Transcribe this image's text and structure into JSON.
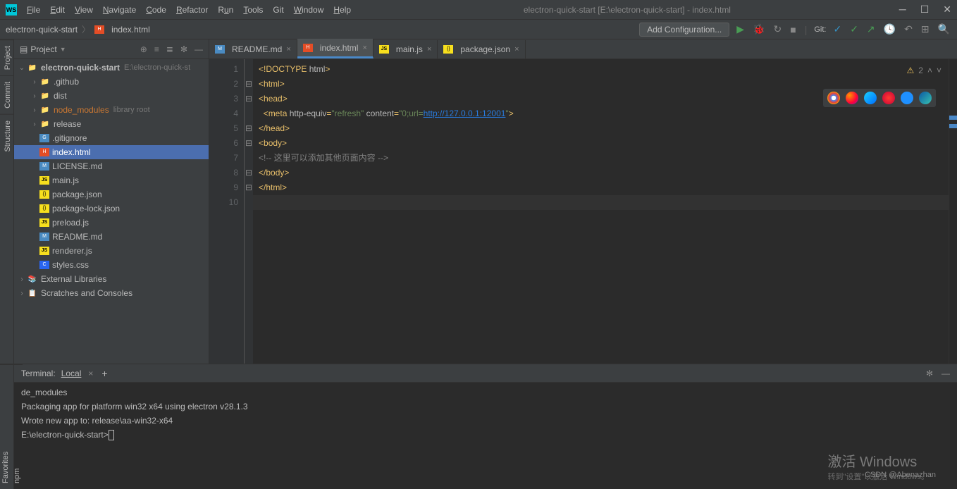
{
  "title": "electron-quick-start [E:\\electron-quick-start] - index.html",
  "menu": [
    "File",
    "Edit",
    "View",
    "Navigate",
    "Code",
    "Refactor",
    "Run",
    "Tools",
    "Git",
    "Window",
    "Help"
  ],
  "menu_underline": [
    "F",
    "E",
    "V",
    "N",
    "C",
    "R",
    "u",
    "T",
    "",
    "W",
    "H"
  ],
  "breadcrumb": {
    "root": "electron-quick-start",
    "file": "index.html"
  },
  "nav": {
    "add_config": "Add Configuration...",
    "git": "Git:"
  },
  "sidebar": {
    "title": "Project",
    "root": {
      "name": "electron-quick-start",
      "hint": "E:\\electron-quick-st"
    },
    "items": [
      {
        "name": ".github",
        "type": "folder",
        "indent": 1,
        "chevron": "›"
      },
      {
        "name": "dist",
        "type": "folder",
        "indent": 1,
        "chevron": "›"
      },
      {
        "name": "node_modules",
        "type": "folder",
        "indent": 1,
        "chevron": "›",
        "lib": true,
        "hint": "library root"
      },
      {
        "name": "release",
        "type": "folder",
        "indent": 1,
        "chevron": "›"
      },
      {
        "name": ".gitignore",
        "type": "file",
        "icon": "git",
        "indent": 1
      },
      {
        "name": "index.html",
        "type": "file",
        "icon": "html",
        "indent": 1,
        "selected": true
      },
      {
        "name": "LICENSE.md",
        "type": "file",
        "icon": "md",
        "indent": 1
      },
      {
        "name": "main.js",
        "type": "file",
        "icon": "js",
        "indent": 1
      },
      {
        "name": "package.json",
        "type": "file",
        "icon": "json",
        "indent": 1
      },
      {
        "name": "package-lock.json",
        "type": "file",
        "icon": "json",
        "indent": 1
      },
      {
        "name": "preload.js",
        "type": "file",
        "icon": "js",
        "indent": 1
      },
      {
        "name": "README.md",
        "type": "file",
        "icon": "md",
        "indent": 1
      },
      {
        "name": "renderer.js",
        "type": "file",
        "icon": "js",
        "indent": 1
      },
      {
        "name": "styles.css",
        "type": "file",
        "icon": "css",
        "indent": 1
      }
    ],
    "ext_libs": "External Libraries",
    "scratches": "Scratches and Consoles"
  },
  "tabs": [
    {
      "label": "README.md",
      "icon": "md",
      "active": false
    },
    {
      "label": "index.html",
      "icon": "html",
      "active": true
    },
    {
      "label": "main.js",
      "icon": "js",
      "active": false
    },
    {
      "label": "package.json",
      "icon": "json",
      "active": false
    }
  ],
  "editor": {
    "warnings": "2",
    "lines": [
      {
        "n": 1,
        "html": "<span class='punct'>&lt;!</span><span class='tag'>DOCTYPE </span><span class='attr'>html</span><span class='punct'>&gt;</span>"
      },
      {
        "n": 2,
        "html": "<span class='punct'>&lt;</span><span class='tag'>html</span><span class='punct'>&gt;</span>",
        "fold": "⊟"
      },
      {
        "n": 3,
        "html": "<span class='punct'>&lt;</span><span class='tag'>head</span><span class='punct'>&gt;</span>",
        "fold": "⊟"
      },
      {
        "n": 4,
        "html": "  <span class='punct'>&lt;</span><span class='tag'>meta </span><span class='attr'>http-equiv</span><span class='punct'>=</span><span class='str'>\"refresh\"</span> <span class='attr'>content</span><span class='punct'>=</span><span class='str'>\"0;url=</span><span class='link'>http://127.0.0.1:12001</span><span class='str'>\"</span><span class='punct'>&gt;</span>"
      },
      {
        "n": 5,
        "html": "<span class='punct'>&lt;/</span><span class='tag'>head</span><span class='punct'>&gt;</span>",
        "fold": "⊟"
      },
      {
        "n": 6,
        "html": "<span class='punct'>&lt;</span><span class='tag'>body</span><span class='punct'>&gt;</span>",
        "fold": "⊟"
      },
      {
        "n": 7,
        "html": "<span class='comm'>&lt;!-- 这里可以添加其他页面内容 --&gt;</span>"
      },
      {
        "n": 8,
        "html": "<span class='punct'>&lt;/</span><span class='tag'>body</span><span class='punct'>&gt;</span>",
        "fold": "⊟"
      },
      {
        "n": 9,
        "html": "<span class='punct'>&lt;/</span><span class='tag'>html</span><span class='punct'>&gt;</span>",
        "fold": "⊟"
      },
      {
        "n": 10,
        "html": "<span class='caret'></span>",
        "hl": true
      }
    ]
  },
  "terminal": {
    "label": "Terminal:",
    "tab": "Local",
    "lines": [
      "de_modules",
      "",
      "Packaging app for platform win32 x64 using electron v28.1.3",
      "Wrote new app to: release\\aa-win32-x64",
      "",
      "E:\\electron-quick-start>"
    ]
  },
  "left_tabs": [
    "Project",
    "Commit",
    "Structure",
    "Favorites",
    "npm"
  ],
  "watermark": {
    "big": "激活 Windows",
    "small": "转到\"设置\"以激活 Windows。"
  },
  "csdn": "CSDN @Abenazhan"
}
